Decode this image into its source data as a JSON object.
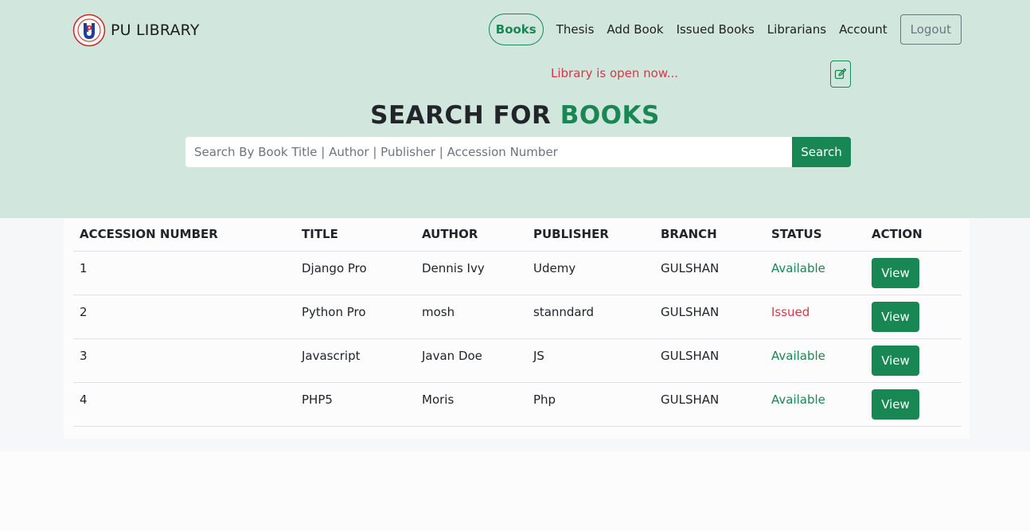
{
  "brand": {
    "name": "PU LIBRARY",
    "logo_letters": "PU"
  },
  "nav": {
    "items": [
      {
        "label": "Books",
        "active": true
      },
      {
        "label": "Thesis"
      },
      {
        "label": "Add Book"
      },
      {
        "label": "Issued Books"
      },
      {
        "label": "Librarians"
      },
      {
        "label": "Account"
      }
    ],
    "logout_label": "Logout"
  },
  "library_status": "Library is open now...",
  "icons": {
    "edit": "edit-icon",
    "logo": "university-seal-icon"
  },
  "search": {
    "title_prefix": "SEARCH FOR",
    "title_accent": "BOOKS",
    "placeholder": "Search By Book Title | Author | Publisher | Accession Number",
    "value": "",
    "button_label": "Search"
  },
  "table": {
    "columns": [
      "ACCESSION NUMBER",
      "TITLE",
      "AUTHOR",
      "PUBLISHER",
      "BRANCH",
      "STATUS",
      "ACTION"
    ],
    "rows": [
      {
        "accession": "1",
        "title": "Django Pro",
        "author": "Dennis Ivy",
        "publisher": "Udemy",
        "branch": "GULSHAN",
        "status": "Available",
        "action": "View"
      },
      {
        "accession": "2",
        "title": "Python Pro",
        "author": "mosh",
        "publisher": "stanndard",
        "branch": "GULSHAN",
        "status": "Issued",
        "action": "View"
      },
      {
        "accession": "3",
        "title": "Javascript",
        "author": "Javan Doe",
        "publisher": "JS",
        "branch": "GULSHAN",
        "status": "Available",
        "action": "View"
      },
      {
        "accession": "4",
        "title": "PHP5",
        "author": "Moris",
        "publisher": "Php",
        "branch": "GULSHAN",
        "status": "Available",
        "action": "View"
      }
    ]
  },
  "colors": {
    "accent": "#198754",
    "danger": "#dc3545",
    "hero_bg": "#d1e7dd"
  }
}
